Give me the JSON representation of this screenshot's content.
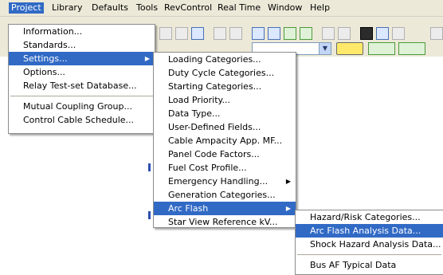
{
  "menubar": {
    "items": [
      "Project",
      "Library",
      "Defaults",
      "Tools",
      "RevControl",
      "Real Time",
      "Window",
      "Help"
    ],
    "active_index": 0
  },
  "project_menu": {
    "items": [
      {
        "label": "Information...",
        "submenu": false
      },
      {
        "label": "Standards...",
        "submenu": false
      },
      {
        "label": "Settings...",
        "submenu": true,
        "selected": true
      },
      {
        "label": "Options...",
        "submenu": false
      },
      {
        "label": "Relay Test-set Database...",
        "submenu": false
      },
      {
        "separator": true
      },
      {
        "label": "Mutual Coupling Group...",
        "submenu": false
      },
      {
        "label": "Control Cable Schedule...",
        "submenu": false
      }
    ]
  },
  "settings_menu": {
    "items": [
      {
        "label": "Loading Categories...",
        "submenu": false
      },
      {
        "label": "Duty Cycle Categories...",
        "submenu": false
      },
      {
        "label": "Starting Categories...",
        "submenu": false
      },
      {
        "label": "Load Priority...",
        "submenu": false
      },
      {
        "label": "Data Type...",
        "submenu": false
      },
      {
        "label": "User-Defined Fields...",
        "submenu": false
      },
      {
        "label": "Cable Ampacity App. MF...",
        "submenu": false
      },
      {
        "label": "Panel Code Factors...",
        "submenu": false
      },
      {
        "label": "Fuel Cost Profile...",
        "submenu": false
      },
      {
        "label": "Emergency Handling...",
        "submenu": true
      },
      {
        "label": "Generation Categories...",
        "submenu": false
      },
      {
        "label": "Arc Flash",
        "submenu": true,
        "selected": true
      },
      {
        "label": "Star View Reference kV...",
        "submenu": false
      }
    ]
  },
  "arcflash_menu": {
    "items": [
      {
        "label": "Hazard/Risk Categories...",
        "selected": false
      },
      {
        "label": "Arc Flash Analysis Data...",
        "selected": true
      },
      {
        "label": "Shock Hazard Analysis Data...",
        "selected": false
      },
      {
        "separator": true
      },
      {
        "label": "Bus AF Typical Data",
        "selected": false
      }
    ]
  },
  "colors": {
    "menubar_bg": "#ece9d8",
    "highlight": "#316ac5",
    "highlight_text": "#ffffff",
    "menu_bg": "#ffffff"
  },
  "icons": [
    "zoom-in-icon",
    "zoom-out-icon",
    "zoom-fit-icon",
    "undo-icon",
    "redo-icon",
    "grid-icon",
    "toggle-icon",
    "drive-icon",
    "print-icon",
    "layout-icon",
    "edit-icon"
  ]
}
